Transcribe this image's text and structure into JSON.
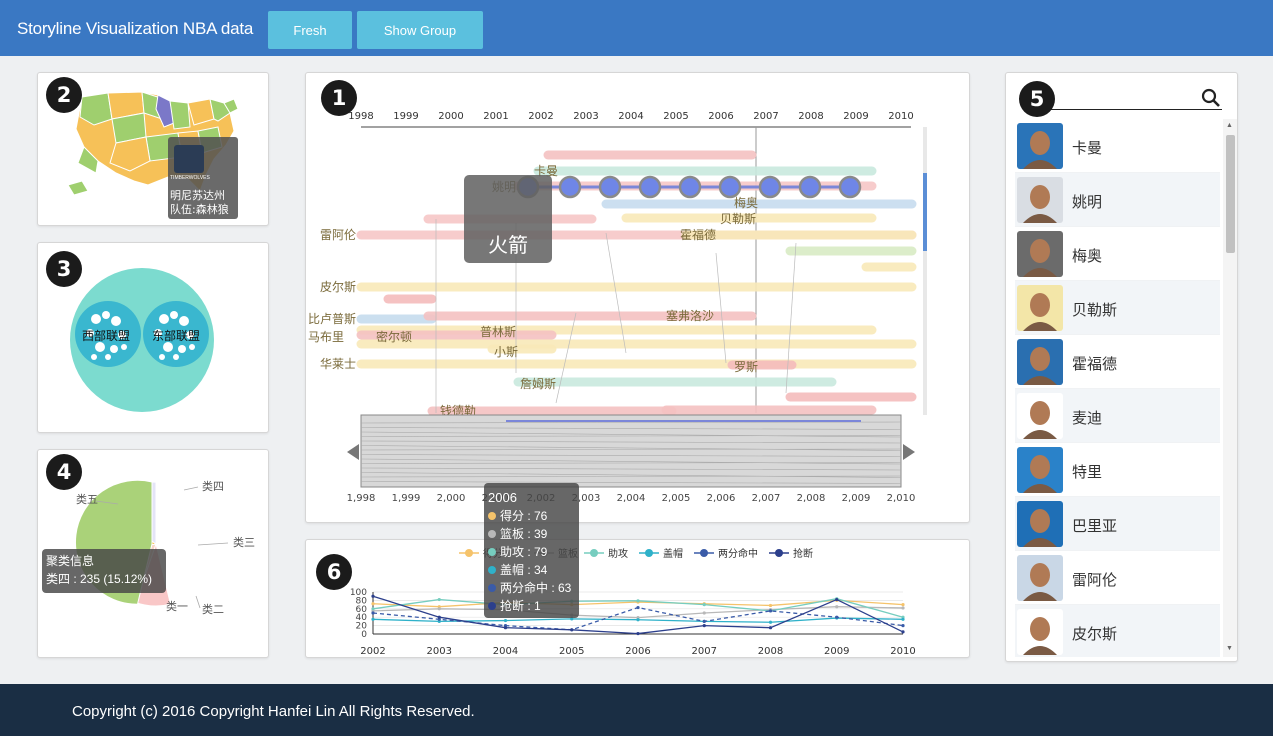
{
  "header": {
    "title": "Storyline Visualization NBA data",
    "fresh_label": "Fresh",
    "show_group_label": "Show Group"
  },
  "footer": {
    "copyright": "Copyright (c) 2016 Copyright Hanfei Lin All Rights Reserved."
  },
  "badges": {
    "b1": "1",
    "b2": "2",
    "b3": "3",
    "b4": "4",
    "b5": "5",
    "b6": "6"
  },
  "map_panel": {
    "team_logo_text": "TIMBERWOLVES",
    "tooltip_line1": "明尼苏达州",
    "tooltip_line2": "队伍:森林狼"
  },
  "league_panel": {
    "west": "西部联盟",
    "east": "东部联盟"
  },
  "pie_panel": {
    "chart_data": {
      "type": "pie",
      "categories": [
        "类一",
        "类二",
        "类三",
        "类四",
        "类五"
      ],
      "values": [
        141,
        265,
        195,
        235,
        719
      ],
      "legend": "none"
    },
    "colors": [
      "#f9c7c7",
      "#f7d5c7",
      "#f5bf4a",
      "#e4e4f7",
      "#aad279"
    ],
    "tooltip_title": "聚类信息",
    "tooltip_value": "类四 : 235 (15.12%)"
  },
  "storyline": {
    "chart_data": {
      "type": "line",
      "years": [
        "1998",
        "1999",
        "2000",
        "2001",
        "2002",
        "2003",
        "2004",
        "2005",
        "2006",
        "2007",
        "2008",
        "2009",
        "2010"
      ],
      "slider_ticks": [
        "1,998",
        "1,999",
        "2,000",
        "2,001",
        "2,002",
        "2,003",
        "2,004",
        "2,005",
        "2,006",
        "2,007",
        "2,008",
        "2,009",
        "2,010"
      ],
      "players": [
        "卡曼",
        "姚明",
        "梅奥",
        "贝勒斯",
        "雷阿伦",
        "霍福德",
        "皮尔斯",
        "比卢普斯",
        "塞弗洛沙",
        "马布里",
        "密尔顿",
        "普林斯",
        "小斯",
        "华莱士",
        "罗斯",
        "詹姆斯",
        "钱德勒"
      ],
      "highlight_team": "火箭"
    }
  },
  "players_panel": {
    "search_placeholder": "",
    "players": [
      "卡曼",
      "姚明",
      "梅奥",
      "贝勒斯",
      "霍福德",
      "麦迪",
      "特里",
      "巴里亚",
      "雷阿伦",
      "皮尔斯"
    ],
    "avatar_bg": [
      "#2a74b8",
      "#d9dde3",
      "#6b6b6b",
      "#f3e6a8",
      "#2a6fb0",
      "#ffffff",
      "#2a82c9",
      "#1f6fb6",
      "#c9d7e6",
      "#ffffff"
    ]
  },
  "stats_panel": {
    "legend": [
      "得分",
      "篮板",
      "助攻",
      "盖帽",
      "两分命中",
      "抢断"
    ],
    "colors": [
      "#f5c36b",
      "#b8b8b8",
      "#76cdbf",
      "#2fb1c9",
      "#3a5ba8",
      "#2c3f8c"
    ],
    "chart_data": {
      "type": "line",
      "x": [
        "2002",
        "2003",
        "2004",
        "2005",
        "2006",
        "2007",
        "2008",
        "2009",
        "2010"
      ],
      "y_ticks": [
        "0",
        "20",
        "40",
        "60",
        "80",
        "100"
      ],
      "ylim": [
        0,
        100
      ],
      "series": [
        {
          "name": "得分",
          "values": [
            72,
            65,
            75,
            70,
            76,
            72,
            68,
            80,
            70
          ]
        },
        {
          "name": "篮板",
          "values": [
            55,
            60,
            58,
            45,
            39,
            50,
            58,
            65,
            62
          ]
        },
        {
          "name": "助攻",
          "values": [
            60,
            82,
            70,
            78,
            79,
            70,
            55,
            84,
            40
          ]
        },
        {
          "name": "盖帽",
          "values": [
            35,
            30,
            32,
            36,
            34,
            30,
            28,
            38,
            35
          ]
        },
        {
          "name": "两分命中",
          "values": [
            50,
            35,
            20,
            10,
            63,
            30,
            55,
            40,
            20
          ]
        },
        {
          "name": "抢断",
          "values": [
            90,
            40,
            15,
            10,
            1,
            20,
            15,
            82,
            5
          ]
        }
      ]
    },
    "tooltip": {
      "year": "2006",
      "lines": [
        "得分 : 76",
        "篮板 : 39",
        "助攻 : 79",
        "盖帽 : 34",
        "两分命中 : 63",
        "抢断 : 1"
      ]
    }
  }
}
